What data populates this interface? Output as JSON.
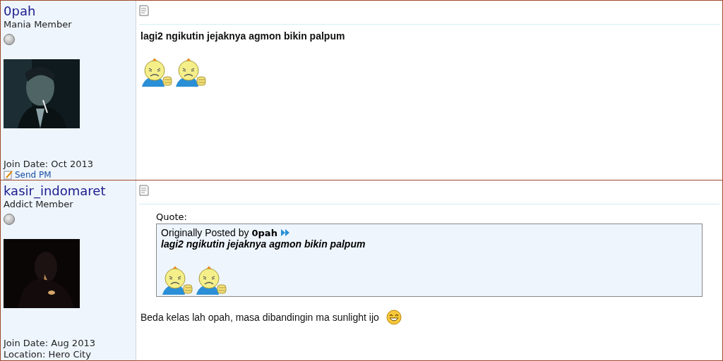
{
  "posts": [
    {
      "author": {
        "name": "0pah",
        "rank": "Mania Member",
        "online": false,
        "details": [
          {
            "kind": "text",
            "text": "Join Date: Oct 2013"
          },
          {
            "kind": "send_pm",
            "text": "Send PM"
          }
        ]
      },
      "message": {
        "body": {
          "text": "lagi2 ngikutin jejaknya agmon bikin palpum",
          "bold": true
        },
        "smilies": [
          {
            "kind": "thumbs_down"
          },
          {
            "kind": "thumbs_down"
          }
        ]
      }
    },
    {
      "author": {
        "name": "kasir_indomaret",
        "rank": "Addict Member",
        "online": false,
        "details": [
          {
            "kind": "text",
            "text": "Join Date: Aug 2013"
          },
          {
            "kind": "text",
            "text": "Location: Hero City"
          }
        ]
      },
      "message": {
        "quote": {
          "label": "Quote:",
          "prefix": "Originally Posted by",
          "author": "0pah",
          "text": "lagi2 ngikutin jejaknya agmon bikin palpum",
          "smilies": [
            {
              "kind": "thumbs_down"
            },
            {
              "kind": "thumbs_down"
            }
          ]
        },
        "body": {
          "text": "Beda kelas lah opah, masa dibandingin ma sunlight ijo",
          "bold": false
        },
        "inline_smilies": [
          {
            "kind": "grin"
          }
        ]
      }
    }
  ]
}
